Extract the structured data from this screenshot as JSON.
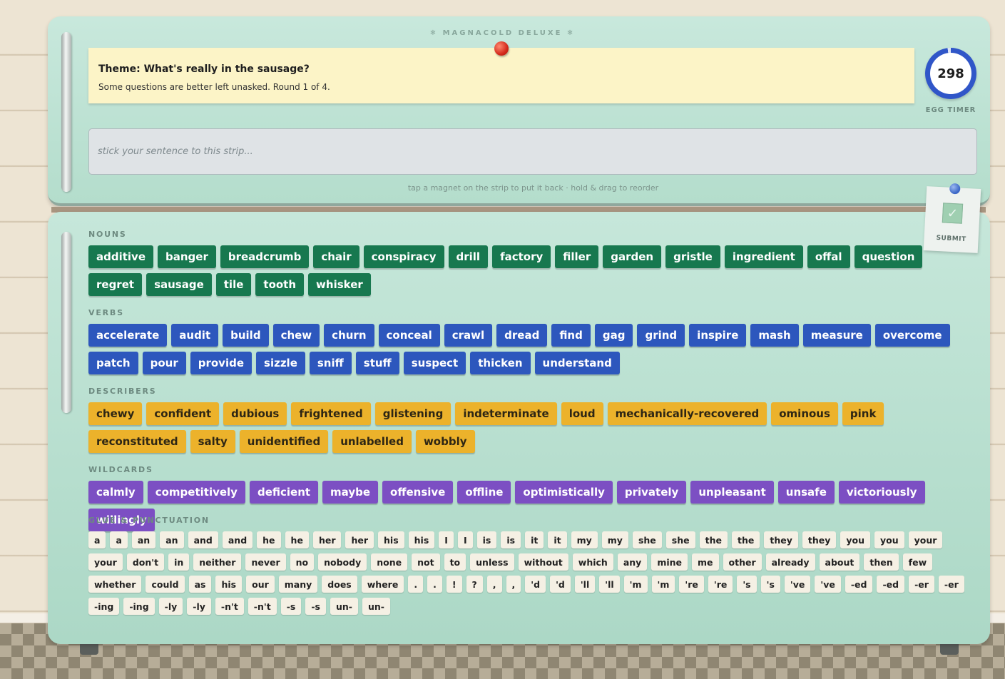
{
  "brand": "❄ MAGNACOLD DELUXE ❄",
  "theme": {
    "title": "Theme: What's really in the sausage?",
    "subtitle": "Some questions are better left unasked. Round 1 of 4."
  },
  "timer": {
    "value": "298",
    "label": "EGG TIMER"
  },
  "strip": {
    "placeholder": "stick your sentence to this strip..."
  },
  "hint": "tap a magnet on the strip to put it back · hold & drag to reorder",
  "submit": {
    "label": "SUBMIT",
    "icon": "check-icon",
    "glyph": "✓"
  },
  "colors": {
    "nouns": "#17784f",
    "verbs": "#2d57bd",
    "describers": "#ecb22b",
    "wildcards": "#7c4fc3",
    "glue": "#f5f0e4"
  },
  "sections": {
    "nouns": {
      "title": "NOUNS",
      "words": [
        "additive",
        "banger",
        "breadcrumb",
        "chair",
        "conspiracy",
        "drill",
        "factory",
        "filler",
        "garden",
        "gristle",
        "ingredient",
        "offal",
        "question",
        "regret",
        "sausage",
        "tile",
        "tooth",
        "whisker"
      ]
    },
    "verbs": {
      "title": "VERBS",
      "words": [
        "accelerate",
        "audit",
        "build",
        "chew",
        "churn",
        "conceal",
        "crawl",
        "dread",
        "find",
        "gag",
        "grind",
        "inspire",
        "mash",
        "measure",
        "overcome",
        "patch",
        "pour",
        "provide",
        "sizzle",
        "sniff",
        "stuff",
        "suspect",
        "thicken",
        "understand"
      ]
    },
    "describers": {
      "title": "DESCRIBERS",
      "words": [
        "chewy",
        "confident",
        "dubious",
        "frightened",
        "glistening",
        "indeterminate",
        "loud",
        "mechanically-recovered",
        "ominous",
        "pink",
        "reconstituted",
        "salty",
        "unidentified",
        "unlabelled",
        "wobbly"
      ]
    },
    "wildcards": {
      "title": "WILDCARDS",
      "words": [
        "calmly",
        "competitively",
        "deficient",
        "maybe",
        "offensive",
        "offline",
        "optimistically",
        "privately",
        "unpleasant",
        "unsafe",
        "victoriously",
        "willingly"
      ]
    },
    "glue": {
      "title": "GLUE & PUNCTUATION",
      "words": [
        "a",
        "a",
        "an",
        "an",
        "and",
        "and",
        "he",
        "he",
        "her",
        "her",
        "his",
        "his",
        "I",
        "I",
        "is",
        "is",
        "it",
        "it",
        "my",
        "my",
        "she",
        "she",
        "the",
        "the",
        "they",
        "they",
        "you",
        "you",
        "your",
        "your",
        "don't",
        "in",
        "neither",
        "never",
        "no",
        "nobody",
        "none",
        "not",
        "to",
        "unless",
        "without",
        "which",
        "any",
        "mine",
        "me",
        "other",
        "already",
        "about",
        "then",
        "few",
        "whether",
        "could",
        "as",
        "his",
        "our",
        "many",
        "does",
        "where",
        ".",
        ".",
        "!",
        "?",
        ",",
        ",",
        "'d",
        "'d",
        "'ll",
        "'ll",
        "'m",
        "'m",
        "'re",
        "'re",
        "'s",
        "'s",
        "'ve",
        "'ve",
        "-ed",
        "-ed",
        "-er",
        "-er",
        "-ing",
        "-ing",
        "-ly",
        "-ly",
        "-n't",
        "-n't",
        "-s",
        "-s",
        "un-",
        "un-"
      ]
    }
  }
}
